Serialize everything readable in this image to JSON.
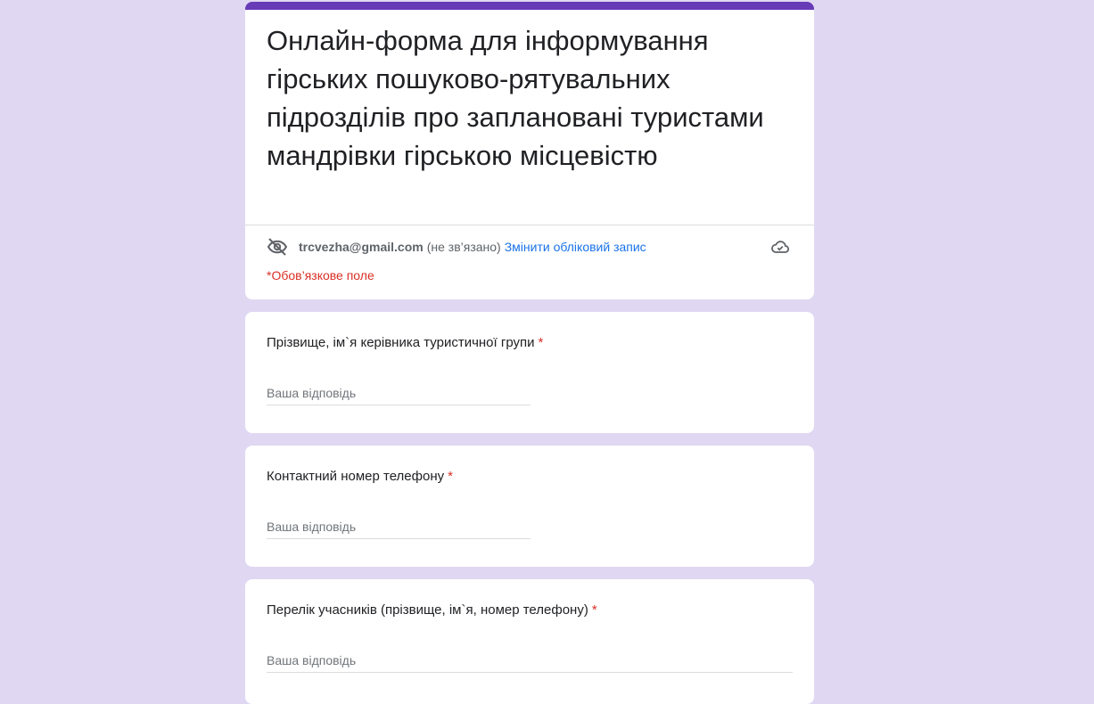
{
  "form": {
    "title": "Онлайн-форма для інформування гірських пошуково-рятувальних підрозділів про заплановані туристами мандрівки гірською місцевістю",
    "accent_color": "#673ab7",
    "background_color": "#e0d8f2"
  },
  "account": {
    "email": "trcvezha@gmail.com",
    "status": "(не зв’язано)",
    "switch_label": "Змінити обліковий запис",
    "privacy_icon": "eye-off-icon",
    "save_icon": "cloud-saved-icon"
  },
  "required_note": "*Обов’язкове поле",
  "questions": [
    {
      "label": "Прізвище, ім`я керівника туристичної групи",
      "required_mark": "*",
      "placeholder": "Ваша відповідь"
    },
    {
      "label": "Контактний номер телефону",
      "required_mark": "*",
      "placeholder": "Ваша відповідь"
    },
    {
      "label": "Перелік учасників (прізвище, ім`я, номер телефону)",
      "required_mark": "*",
      "placeholder": "Ваша відповідь"
    }
  ]
}
